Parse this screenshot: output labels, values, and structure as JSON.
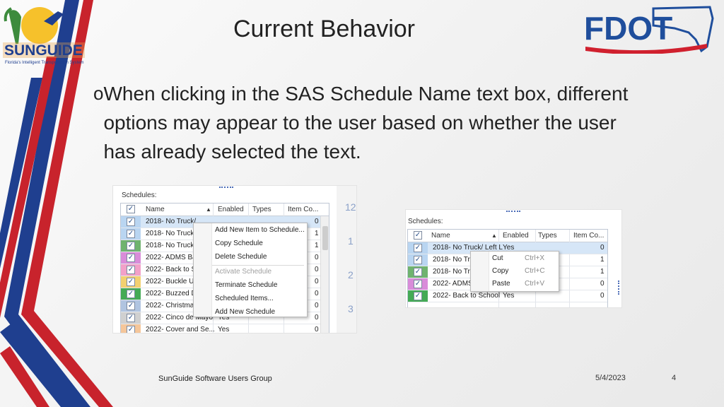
{
  "slide": {
    "title": "Current Behavior",
    "bullet_marker": "o",
    "bullet_text": "When clicking in the SAS Schedule Name text box, different options may appear to the user based on whether the user has already selected the text.",
    "footer_group": "SunGuide Software Users Group",
    "footer_date": "5/4/2023",
    "page_number": "4"
  },
  "logos": {
    "sunguide": {
      "text": "SUNGUIDE",
      "tagline": "Florida's Intelligent Transportation System",
      "icon": "sunguide-logo"
    },
    "fdot": {
      "text": "FDOT",
      "icon": "fdot-florida-logo"
    }
  },
  "colors": {
    "stripe_blue": "#1f3f8f",
    "stripe_red": "#c8232c",
    "fdot_blue": "#1f4e9c",
    "fdot_red": "#d0202e",
    "row_highlight": "#d6e6f7"
  },
  "screenshot_left": {
    "section_label": "Schedules:",
    "columns": {
      "name": "Name",
      "enabled": "Enabled",
      "types": "Types",
      "item_count": "Item Co..."
    },
    "rows": [
      {
        "name": "2018- No Truck/",
        "enabled": "",
        "count": "0",
        "color": "#b9d5f1"
      },
      {
        "name": "2018- No Truck/",
        "enabled": "",
        "count": "1",
        "color": "#b9d5f1"
      },
      {
        "name": "2018- No Trucks",
        "enabled": "",
        "count": "1",
        "color": "#6fb36f"
      },
      {
        "name": "2022- ADMS Ba",
        "enabled": "",
        "count": "0",
        "color": "#d98cd9"
      },
      {
        "name": "2022- Back to S",
        "enabled": "",
        "count": "0",
        "color": "#f2a0c8"
      },
      {
        "name": "2022- Buckle Up",
        "enabled": "",
        "count": "0",
        "color": "#f2d070"
      },
      {
        "name": "2022- Buzzed D",
        "enabled": "",
        "count": "0",
        "color": "#44aa55"
      },
      {
        "name": "2022- Christmas",
        "enabled": "",
        "count": "0",
        "color": "#b0c4e0"
      },
      {
        "name": "2022- Cinco de Mayo",
        "enabled": "Yes",
        "count": "0",
        "color": "#d0d0d0"
      },
      {
        "name": "2022- Cover and Se...",
        "enabled": "Yes",
        "count": "0",
        "color": "#f5c69a"
      }
    ],
    "side_numbers": [
      "12",
      "1",
      "2",
      "3"
    ],
    "context_menu": [
      {
        "label": "Add New Item to Schedule...",
        "disabled": false
      },
      {
        "label": "Copy Schedule",
        "disabled": false
      },
      {
        "label": "Delete Schedule",
        "disabled": false
      },
      {
        "label": "Activate Schedule",
        "disabled": true
      },
      {
        "label": "Terminate Schedule",
        "disabled": false
      },
      {
        "label": "Scheduled Items...",
        "disabled": false
      },
      {
        "label": "Add New Schedule",
        "disabled": false
      }
    ]
  },
  "screenshot_right": {
    "section_label": "Schedules:",
    "columns": {
      "name": "Name",
      "enabled": "Enabled",
      "types": "Types",
      "item_count": "Item Co..."
    },
    "rows": [
      {
        "name": "2018- No Truck/ Left L",
        "enabled": "Yes",
        "count": "0",
        "color": "#b9d5f1"
      },
      {
        "name": "2018- No Tru",
        "enabled": "",
        "count": "1",
        "color": "#b9d5f1"
      },
      {
        "name": "2018- No Tru",
        "enabled": "",
        "count": "1",
        "color": "#6fb36f"
      },
      {
        "name": "2022- ADMS",
        "enabled": "",
        "count": "0",
        "color": "#d98cd9"
      },
      {
        "name": "2022- Back to School",
        "enabled": "Yes",
        "count": "0",
        "color": "#44aa55"
      }
    ],
    "context_menu": [
      {
        "label": "Cut",
        "shortcut": "Ctrl+X"
      },
      {
        "label": "Copy",
        "shortcut": "Ctrl+C"
      },
      {
        "label": "Paste",
        "shortcut": "Ctrl+V"
      }
    ]
  }
}
